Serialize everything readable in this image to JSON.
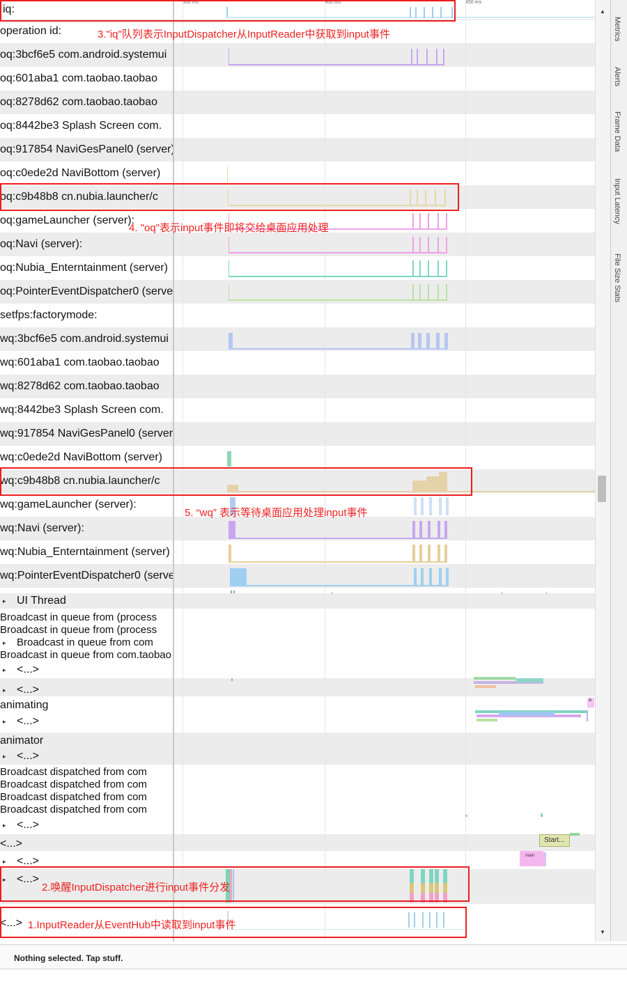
{
  "ruler": {
    "label": "iq:",
    "ticks": [
      "350 ms",
      "400 ms",
      "450 ms"
    ]
  },
  "rows": [
    {
      "label": "operation id:",
      "expandable": false
    },
    {
      "label": "oq:3bcf6e5 com.android.systemui",
      "expandable": false
    },
    {
      "label": "oq:601aba1 com.taobao.taobao",
      "expandable": false
    },
    {
      "label": "oq:8278d62 com.taobao.taobao",
      "expandable": false
    },
    {
      "label": "oq:8442be3 Splash Screen com.",
      "expandable": false
    },
    {
      "label": "oq:917854 NaviGesPanel0 (server)",
      "expandable": false
    },
    {
      "label": "oq:c0ede2d NaviBottom (server)",
      "expandable": false
    },
    {
      "label": "oq:c9b48b8 cn.nubia.launcher/c",
      "expandable": false
    },
    {
      "label": "oq:gameLauncher (server):",
      "expandable": false
    },
    {
      "label": "oq:Navi (server):",
      "expandable": false
    },
    {
      "label": "oq:Nubia_Enterntainment (server)",
      "expandable": false
    },
    {
      "label": "oq:PointerEventDispatcher0 (server)",
      "expandable": false
    },
    {
      "label": "setfps:factorymode:",
      "expandable": false
    },
    {
      "label": "wq:3bcf6e5 com.android.systemui",
      "expandable": false
    },
    {
      "label": "wq:601aba1 com.taobao.taobao",
      "expandable": false
    },
    {
      "label": "wq:8278d62 com.taobao.taobao",
      "expandable": false
    },
    {
      "label": "wq:8442be3 Splash Screen com.",
      "expandable": false
    },
    {
      "label": "wq:917854 NaviGesPanel0 (server)",
      "expandable": false
    },
    {
      "label": "wq:c0ede2d NaviBottom (server)",
      "expandable": false
    },
    {
      "label": "wq:c9b48b8 cn.nubia.launcher/c",
      "expandable": false
    },
    {
      "label": "wq:gameLauncher (server):",
      "expandable": false
    },
    {
      "label": "wq:Navi (server):",
      "expandable": false
    },
    {
      "label": "wq:Nubia_Enterntainment (server)",
      "expandable": false
    },
    {
      "label": "wq:PointerEventDispatcher0 (server)",
      "expandable": false
    },
    {
      "label": "UI Thread",
      "expandable": true
    },
    {
      "label": "<...>",
      "expandable": true
    },
    {
      "label": "<...>",
      "expandable": true
    },
    {
      "label": "animating",
      "expandable": false
    },
    {
      "label": "<...>",
      "expandable": true
    },
    {
      "label": "animator",
      "expandable": false
    },
    {
      "label": "<...>",
      "expandable": true
    },
    {
      "label": "<...>",
      "expandable": true
    },
    {
      "label": "<...>",
      "expandable": false
    },
    {
      "label": "<...>",
      "expandable": true
    },
    {
      "label": "<...>",
      "expandable": true
    },
    {
      "label": "<...>",
      "expandable": false
    }
  ],
  "broadcast_group_1": [
    {
      "label": "Broadcast in queue from (process",
      "expandable": false
    },
    {
      "label": "Broadcast in queue from (process",
      "expandable": false
    },
    {
      "label": "Broadcast in queue from com",
      "expandable": true
    },
    {
      "label": "Broadcast in queue from com.taobao",
      "expandable": false
    }
  ],
  "broadcast_group_2": [
    {
      "label": "Broadcast dispatched from com",
      "expandable": false
    },
    {
      "label": "Broadcast dispatched from com",
      "expandable": false
    },
    {
      "label": "Broadcast dispatched from com",
      "expandable": false
    },
    {
      "label": "Broadcast dispatched from com",
      "expandable": false
    }
  ],
  "slices": {
    "start": "Start...",
    "main": "main",
    "marker": "a"
  },
  "side_tabs": [
    "Metrics",
    "Alerts",
    "Frame Data",
    "Input Latency",
    "File Size Stats"
  ],
  "status": "Nothing selected. Tap stuff.",
  "annotations": {
    "a1": "1.InputReader从EventHub中读取到input事件",
    "a2": "2.唤醒InputDispatcher进行input事件分发",
    "a3": "3.\"iq\"队列表示InputDispatcher从InputReader中获取到input事件",
    "a4": "4. \"oq\"表示input事件即将交给桌面应用处理",
    "a5": "5. “wq” 表示等待桌面应用处理input事件"
  },
  "colors": {
    "annotation_red": "#ee1c1c",
    "row_alt": "#ececec",
    "purple": "#c8a6f0",
    "teal": "#7fd6c2",
    "tan": "#e6cf9a",
    "blue": "#9fcff0",
    "green": "#b8e3a0",
    "pink": "#f0a0e8"
  }
}
